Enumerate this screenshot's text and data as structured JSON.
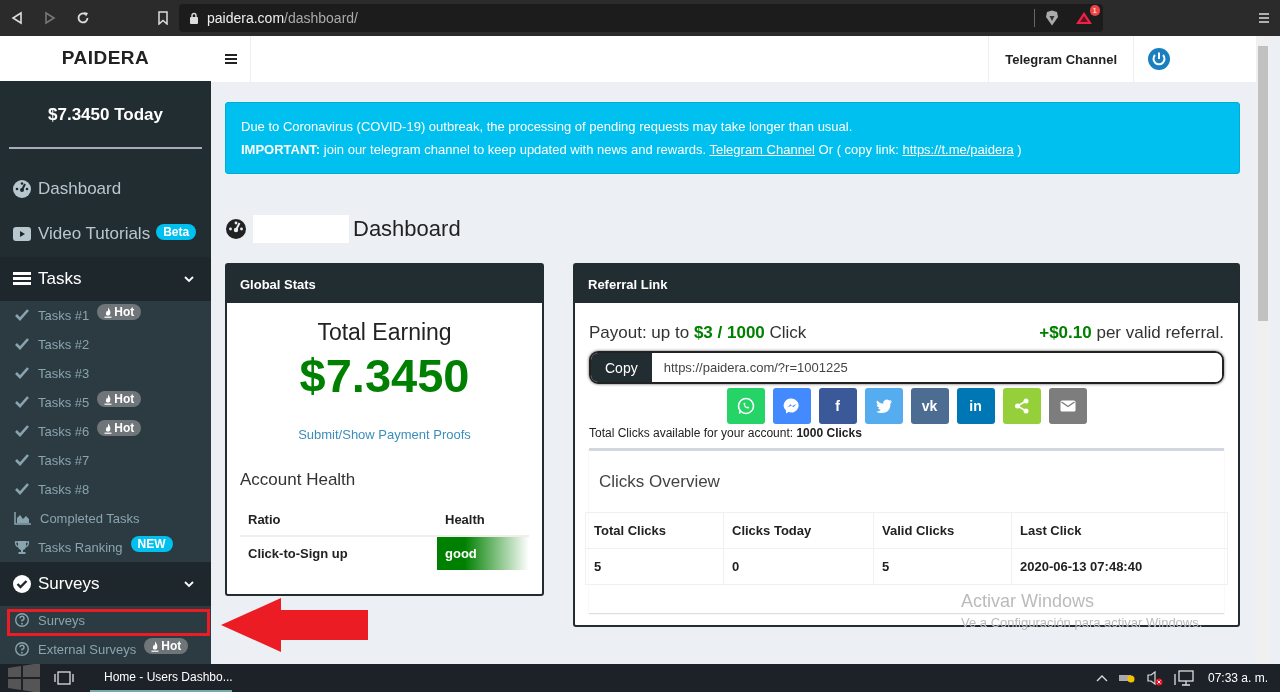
{
  "browser": {
    "url_host": "paidera.com",
    "url_path": "/dashboard/",
    "rewards_badge": "1"
  },
  "sidebar": {
    "brand": "PAIDERA",
    "balance": "$7.3450 Today",
    "links": [
      {
        "kind": "gauge",
        "label": "Dashboard"
      },
      {
        "kind": "video",
        "label": "Video Tutorials",
        "badge": {
          "kind": "beta",
          "text": "Beta"
        }
      }
    ],
    "sections": [
      {
        "kind": "tasks",
        "label": "Tasks",
        "expanded": true,
        "children": [
          {
            "kind": "task",
            "label": "Tasks #1",
            "badge": {
              "kind": "hot",
              "text": "Hot"
            }
          },
          {
            "kind": "task",
            "label": "Tasks #2"
          },
          {
            "kind": "task",
            "label": "Tasks #3"
          },
          {
            "kind": "task",
            "label": "Tasks #5",
            "badge": {
              "kind": "hot",
              "text": "Hot"
            }
          },
          {
            "kind": "task",
            "label": "Tasks #6",
            "badge": {
              "kind": "hot",
              "text": "Hot"
            }
          },
          {
            "kind": "task",
            "label": "Tasks #7"
          },
          {
            "kind": "task",
            "label": "Tasks #8"
          },
          {
            "kind": "chart",
            "label": "Completed Tasks"
          },
          {
            "kind": "trophy",
            "label": "Tasks Ranking",
            "badge": {
              "kind": "new",
              "text": "NEW"
            }
          }
        ]
      },
      {
        "kind": "surveys",
        "label": "Surveys",
        "expanded": true,
        "children": [
          {
            "kind": "question",
            "label": "Surveys"
          },
          {
            "kind": "question",
            "label": "External Surveys",
            "badge": {
              "kind": "hot",
              "text": "Hot"
            }
          }
        ]
      }
    ]
  },
  "topbar": {
    "telegram_link": "Telegram Channel"
  },
  "alert": {
    "line1": "Due to Coronavirus (COVID-19) outbreak, the processing of pending requests may take longer than usual.",
    "line2_lead": "**IMPORTANT:** join our telegram channel to keep updated with news and rewards.",
    "line2_link": "Telegram Channel",
    "line2_middle": "Or ( copy link:",
    "line2_url": "https://t.me/paidera",
    "line2_tail": ")"
  },
  "heading": "Dashboard",
  "global_stats": {
    "title": "Global Stats",
    "total_label": "Total Earning",
    "total": "$7.3450",
    "proofs_link": "Submit/Show Payment Proofs",
    "health_title": "Account Health",
    "columns": [
      "Ratio",
      "Health"
    ],
    "rows": [
      {
        "ratio": "Click-to-Sign up",
        "health": "good"
      }
    ]
  },
  "referral": {
    "title": "Referral Link",
    "payout": "Payout: up to **$3 / 1000** Click",
    "bonus": "**+$0.10** per valid referral.",
    "copy_button": "Copy",
    "link": "https://paidera.com/?r=1001225",
    "share": [
      {
        "kind": "phone",
        "color": "#25d366"
      },
      {
        "kind": "messenger",
        "color": "#448aff"
      },
      {
        "kind": "letters",
        "label": "f",
        "color": "#3b5998"
      },
      {
        "kind": "bird",
        "color": "#55acee"
      },
      {
        "kind": "letters",
        "label": "vk",
        "color": "#4c6c91"
      },
      {
        "kind": "letters",
        "label": "in",
        "color": "#0077b5"
      },
      {
        "kind": "share",
        "color": "#95d03a"
      },
      {
        "kind": "mail",
        "color": "#7d7d7d"
      }
    ],
    "clicks_note": "Total Clicks available for your account: **1000 Clicks**",
    "overview_title": "Clicks Overview",
    "columns": [
      "Total Clicks",
      "Clicks Today",
      "Valid Clicks",
      "Last Click"
    ],
    "rows": [
      [
        "5",
        "0",
        "5",
        "2020-06-13 07:48:40"
      ]
    ]
  },
  "os_notice": {
    "title": "Activar Windows",
    "text": "Ve a Configuración para activar Windows."
  },
  "taskbar": {
    "window": "Home - Users Dashbo...",
    "clock": "07:33 a. m."
  }
}
